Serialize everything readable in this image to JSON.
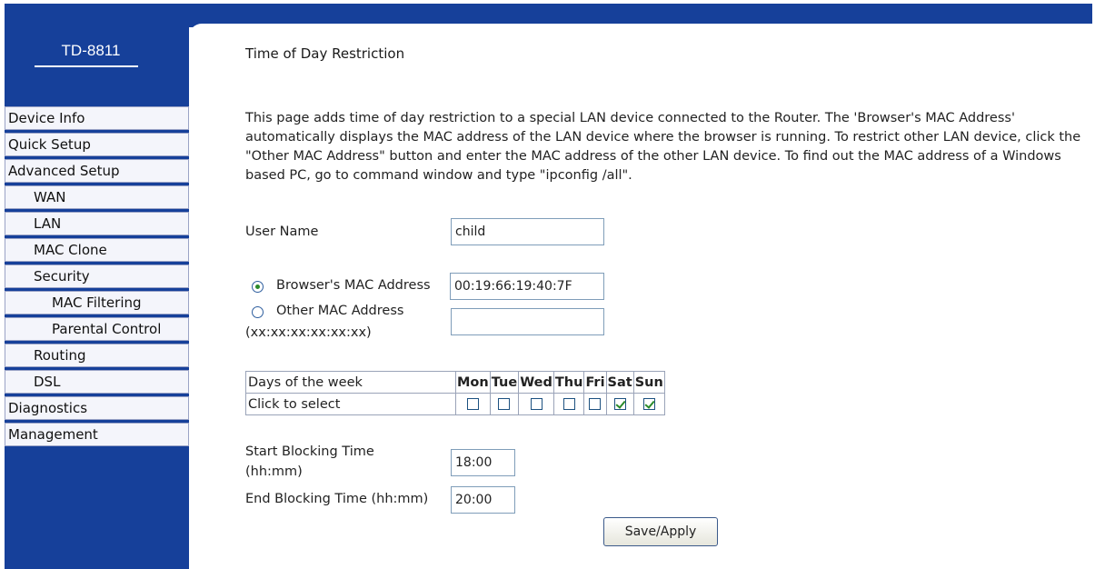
{
  "brand": {
    "model": "TD-8811"
  },
  "sidebar": {
    "items": [
      {
        "label": "Device Info"
      },
      {
        "label": "Quick Setup"
      },
      {
        "label": "Advanced Setup"
      },
      {
        "label": "WAN"
      },
      {
        "label": "LAN"
      },
      {
        "label": "MAC Clone"
      },
      {
        "label": "Security"
      },
      {
        "label": "MAC Filtering"
      },
      {
        "label": "Parental Control"
      },
      {
        "label": "Routing"
      },
      {
        "label": "DSL"
      },
      {
        "label": "Diagnostics"
      },
      {
        "label": "Management"
      }
    ]
  },
  "page": {
    "title": "Time of Day Restriction",
    "description": "This page adds time of day restriction to a special LAN device connected to the Router. The 'Browser's MAC Address' automatically displays the MAC address of the LAN device where the browser is running. To restrict other LAN device, click the \"Other MAC Address\" button and enter the MAC address of the other LAN device. To find out the MAC address of a Windows based PC, go to command window and type \"ipconfig /all\"."
  },
  "form": {
    "user_name_label": "User Name",
    "user_name_value": "child",
    "browser_mac_label": "Browser's MAC Address",
    "browser_mac_value": "00:19:66:19:40:7F",
    "other_mac_label": "Other MAC Address",
    "other_mac_format": "(xx:xx:xx:xx:xx:xx)",
    "other_mac_value": "",
    "selected_mac_option": "browser",
    "days": {
      "row_header": "Days of the week",
      "row_select": "Click to select",
      "names": [
        "Mon",
        "Tue",
        "Wed",
        "Thu",
        "Fri",
        "Sat",
        "Sun"
      ],
      "checked": [
        false,
        false,
        false,
        false,
        false,
        true,
        true
      ]
    },
    "start_label_line1": "Start Blocking Time",
    "start_label_line2": "(hh:mm)",
    "start_value": "18:00",
    "end_label": "End Blocking Time (hh:mm)",
    "end_value": "20:00",
    "save_label": "Save/Apply"
  },
  "colors": {
    "nav_blue": "#16409a",
    "check_green": "#2a8a2a"
  }
}
